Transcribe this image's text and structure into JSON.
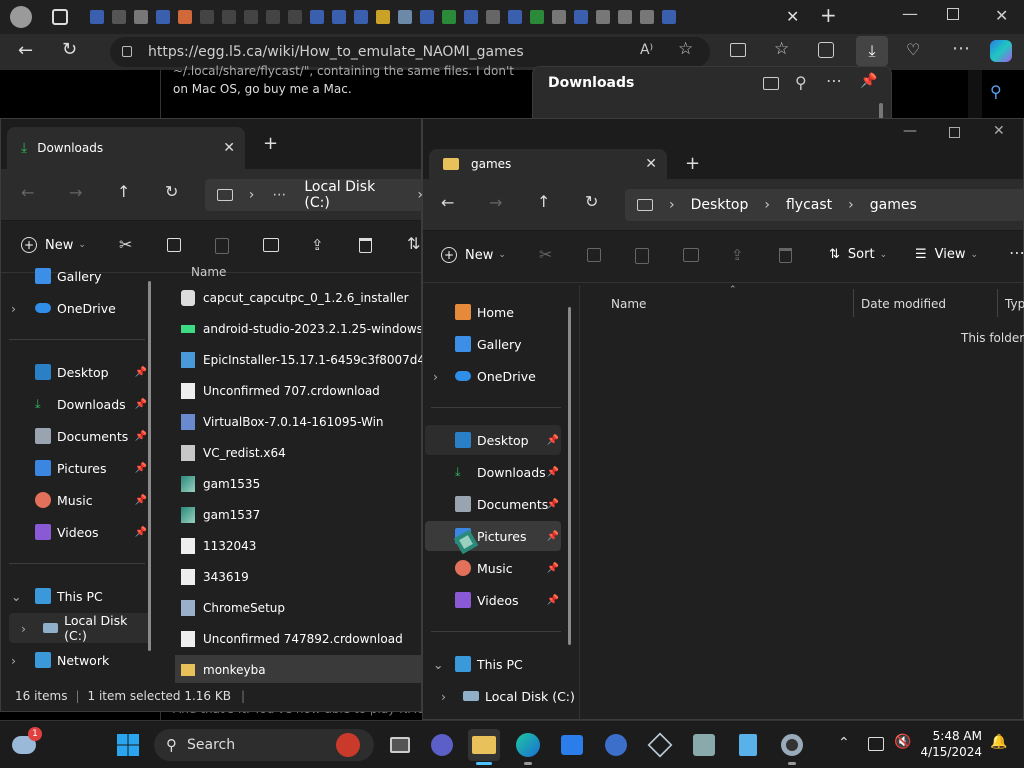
{
  "browser": {
    "url": "https://egg.l5.ca/wiki/How_to_emulate_NAOMI_games",
    "page_line1": "~/.local/share/flycast/\", containing the same files. I don't",
    "page_line2": "on Mac OS, go buy me a Mac.",
    "page_bottom": "And that's it. You've now able to play NAOMI",
    "downloads_title": "Downloads"
  },
  "explorer_left": {
    "tab_title": "Downloads",
    "breadcrumb": [
      "Local Disk (C:)"
    ],
    "new_label": "New",
    "nav": [
      {
        "label": "Gallery",
        "color": "#3d8ee6"
      },
      {
        "label": "OneDrive",
        "color": "#2f8ee8"
      },
      {
        "label": "Desktop",
        "color": "#2a80c6",
        "pinned": true
      },
      {
        "label": "Downloads",
        "color": "#2fb35a",
        "pinned": true
      },
      {
        "label": "Documents",
        "color": "#9aa4b0",
        "pinned": true
      },
      {
        "label": "Pictures",
        "color": "#3a86e0",
        "pinned": true
      },
      {
        "label": "Music",
        "color": "#e2705a",
        "pinned": true
      },
      {
        "label": "Videos",
        "color": "#8a5ad6",
        "pinned": true
      },
      {
        "label": "This PC",
        "color": "#3a9ad9"
      },
      {
        "label": "Local Disk (C:)",
        "color": "#8fb0c8"
      },
      {
        "label": "Network",
        "color": "#3a9ad9"
      }
    ],
    "column_name": "Name",
    "files": [
      "capcut_capcutpc_0_1.2.6_installer",
      "android-studio-2023.2.1.25-windows",
      "EpicInstaller-15.17.1-6459c3f8007d4d38b...",
      "Unconfirmed 707.crdownload",
      "VirtualBox-7.0.14-161095-Win",
      "VC_redist.x64",
      "gam1535",
      "gam1537",
      "1132043",
      "343619",
      "ChromeSetup",
      "Unconfirmed 747892.crdownload",
      "monkeyba"
    ],
    "status_count": "16 items",
    "status_selected": "1 item selected  1.16 KB"
  },
  "explorer_right": {
    "tab_title": "games",
    "breadcrumb": [
      "Desktop",
      "flycast",
      "games"
    ],
    "new_label": "New",
    "sort_label": "Sort",
    "view_label": "View",
    "nav": [
      {
        "label": "Home",
        "color": "#e58a3a"
      },
      {
        "label": "Gallery",
        "color": "#3d8ee6"
      },
      {
        "label": "OneDrive",
        "color": "#2f8ee8"
      },
      {
        "label": "Desktop",
        "color": "#2a80c6",
        "pinned": true
      },
      {
        "label": "Downloads",
        "color": "#2fb35a",
        "pinned": true
      },
      {
        "label": "Documents",
        "color": "#9aa4b0",
        "pinned": true
      },
      {
        "label": "Pictures",
        "color": "#3a86e0",
        "pinned": true
      },
      {
        "label": "Music",
        "color": "#e2705a",
        "pinned": true
      },
      {
        "label": "Videos",
        "color": "#8a5ad6",
        "pinned": true
      },
      {
        "label": "This PC",
        "color": "#3a9ad9"
      },
      {
        "label": "Local Disk (C:)",
        "color": "#8fb0c8"
      }
    ],
    "col_name": "Name",
    "col_date": "Date modified",
    "col_type": "Type",
    "empty_text": "This folder is"
  },
  "taskbar": {
    "search_label": "Search",
    "notification_count": "1",
    "time": "5:48 AM",
    "date": "4/15/2024"
  }
}
